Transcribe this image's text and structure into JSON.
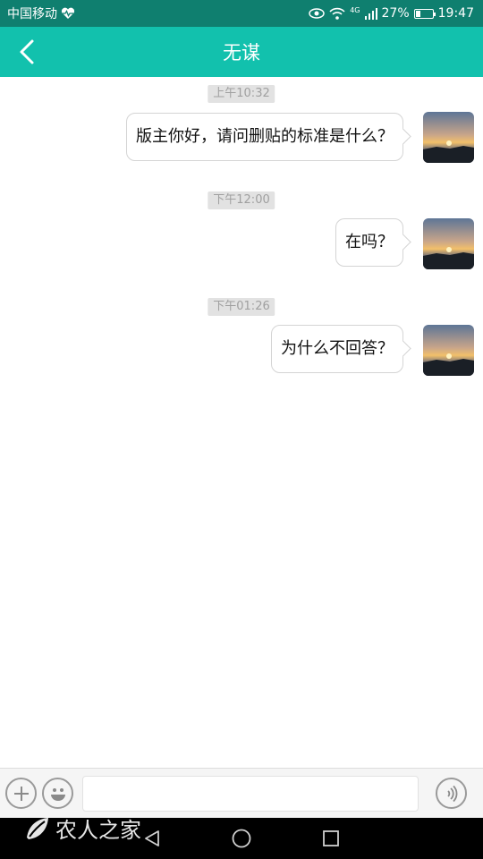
{
  "status_bar": {
    "carrier": "中国移动",
    "network": "4G",
    "battery_percent": "27%",
    "battery_level": 0.27,
    "time": "19:47"
  },
  "header": {
    "title": "无谋"
  },
  "messages": [
    {
      "timestamp": "上午10:32",
      "text": "版主你好，请问删贴的标准是什么？"
    },
    {
      "timestamp": "下午12:00",
      "text": "在吗？"
    },
    {
      "timestamp": "下午01:26",
      "text": "为什么不回答？"
    }
  ],
  "input": {
    "placeholder": ""
  },
  "watermark": {
    "text": "农人之家"
  },
  "colors": {
    "header": "#12c1ad",
    "status_bar": "#0f7f6f",
    "timestamp_bg": "#e2e2e2"
  }
}
